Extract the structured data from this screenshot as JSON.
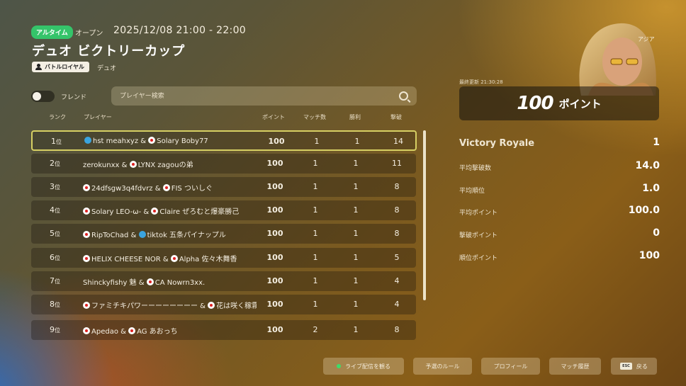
{
  "header": {
    "badge": "アルタイム",
    "status": "オープン",
    "datetime": "2025/12/08 21:00 - 22:00",
    "title": "デュオ ビクトリーカップ",
    "mode": "バトルロイヤル",
    "mode_sub": "デュオ"
  },
  "filters": {
    "friends_label": "フレンド",
    "friends_on": false,
    "search_placeholder": "プレイヤー検索"
  },
  "table": {
    "columns": {
      "rank": "ランク",
      "player": "プレイヤー",
      "points": "ポイント",
      "matches": "マッチ数",
      "wins": "勝利",
      "kills": "撃破"
    },
    "rows": [
      {
        "rank": "1",
        "suffix": "位",
        "p1": "hst meahxyz",
        "p2": "Solary Boby77",
        "points": "100",
        "matches": "1",
        "wins": "1",
        "kills": "14"
      },
      {
        "rank": "2",
        "suffix": "位",
        "p1": "zerokunxx",
        "p2": "LYNX zagouの弟",
        "points": "100",
        "matches": "1",
        "wins": "1",
        "kills": "11"
      },
      {
        "rank": "3",
        "suffix": "位",
        "p1": "24dfsgw3q4fdvrz",
        "p2": "FIS ついしぐ",
        "points": "100",
        "matches": "1",
        "wins": "1",
        "kills": "8"
      },
      {
        "rank": "4",
        "suffix": "位",
        "p1": "Solary LEO-ω-",
        "p2": "Claire ぜろむと爆豪勝己",
        "points": "100",
        "matches": "1",
        "wins": "1",
        "kills": "8"
      },
      {
        "rank": "5",
        "suffix": "位",
        "p1": "RipToChad",
        "p2": "tiktok 五条パイナップル",
        "points": "100",
        "matches": "1",
        "wins": "1",
        "kills": "8"
      },
      {
        "rank": "6",
        "suffix": "位",
        "p1": "HELIX CHEESE NOR",
        "p2": "Alpha 佐々木舞香",
        "points": "100",
        "matches": "1",
        "wins": "1",
        "kills": "5"
      },
      {
        "rank": "7",
        "suffix": "位",
        "p1": "Shinckyfishy 魅",
        "p2": "CA Nowrn3xx.",
        "points": "100",
        "matches": "1",
        "wins": "1",
        "kills": "4"
      },
      {
        "rank": "8",
        "suffix": "位",
        "p1": "ファミチキパワーーーーーーーー",
        "p2": "花は咲く稼霧の知",
        "points": "100",
        "matches": "1",
        "wins": "1",
        "kills": "4"
      },
      {
        "rank": "9",
        "suffix": "位",
        "p1": "Apedao",
        "p2": "AG あおっち",
        "points": "100",
        "matches": "2",
        "wins": "1",
        "kills": "8"
      }
    ]
  },
  "panel": {
    "region": "アジア",
    "updated": "最終更新 21:30:28",
    "points_value": "100",
    "points_unit": "ポイント",
    "stats": [
      {
        "label": "Victory Royale",
        "value": "1"
      },
      {
        "label": "平均撃破数",
        "value": "14.0"
      },
      {
        "label": "平均順位",
        "value": "1.0"
      },
      {
        "label": "平均ポイント",
        "value": "100.0"
      },
      {
        "label": "撃破ポイント",
        "value": "0"
      },
      {
        "label": "順位ポイント",
        "value": "100"
      }
    ]
  },
  "buttons": {
    "live": "ライブ配信を観る",
    "rules": "予選のルール",
    "profile": "プロフィール",
    "history": "マッチ履歴",
    "back": "戻る",
    "esc": "ESC"
  },
  "colors": {
    "live_badge": "#35c46a",
    "selected_border": "#d6cf63"
  }
}
